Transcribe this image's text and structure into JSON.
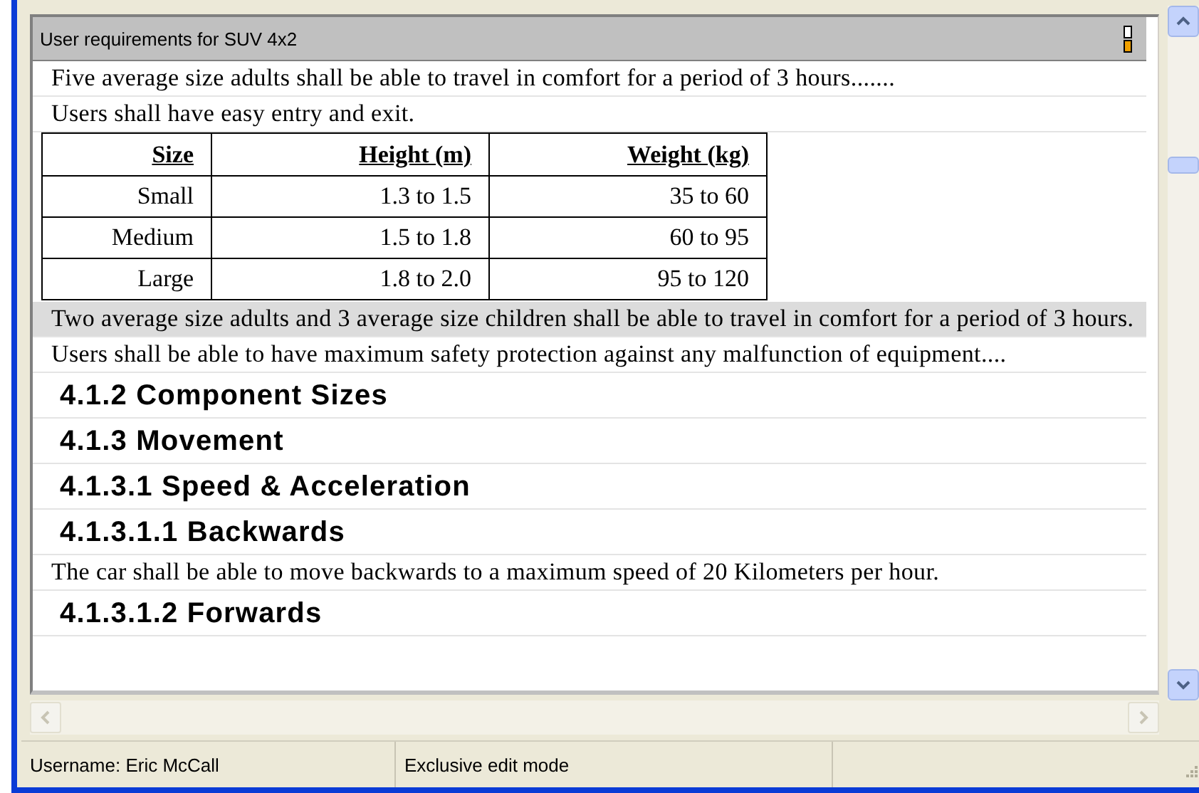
{
  "document": {
    "title": "User requirements for SUV 4x2",
    "items": [
      {
        "kind": "text",
        "text": "Five average size adults shall be able to travel in comfort for a period of 3 hours.......",
        "selected": false
      },
      {
        "kind": "text",
        "text": "Users shall have easy entry and exit.",
        "selected": false
      },
      {
        "kind": "table",
        "columns": [
          "Size",
          "Height (m)",
          "Weight (kg)"
        ],
        "rows": [
          [
            "Small",
            "1.3 to 1.5",
            "35 to 60"
          ],
          [
            "Medium",
            "1.5 to 1.8",
            "60 to 95"
          ],
          [
            "Large",
            "1.8 to 2.0",
            "95 to 120"
          ]
        ],
        "selected": false
      },
      {
        "kind": "text",
        "text": "Two average size adults and 3 average size children shall be able to travel in comfort for a period of 3 hours.",
        "selected": true
      },
      {
        "kind": "text",
        "text": "Users shall be able to have maximum safety protection against any malfunction of equipment....",
        "selected": false
      },
      {
        "kind": "heading",
        "text": "4.1.2 Component Sizes",
        "selected": false
      },
      {
        "kind": "heading",
        "text": "4.1.3 Movement",
        "selected": false
      },
      {
        "kind": "heading",
        "text": "4.1.3.1 Speed & Acceleration",
        "selected": false
      },
      {
        "kind": "heading",
        "text": "4.1.3.1.1 Backwards",
        "selected": false
      },
      {
        "kind": "text",
        "text": "The car shall be able to move backwards to a maximum speed of 20 Kilometers per hour.",
        "selected": false
      },
      {
        "kind": "heading",
        "text": "4.1.3.1.2 Forwards",
        "selected": false
      }
    ]
  },
  "status_bar": [
    "Username: Eric McCall",
    "Exclusive edit mode"
  ]
}
